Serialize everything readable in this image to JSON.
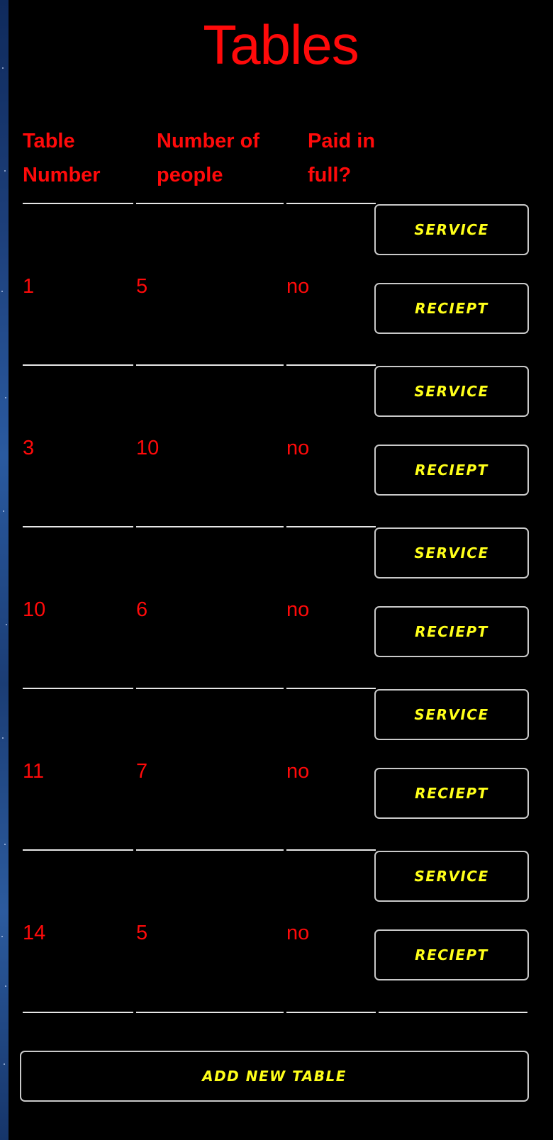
{
  "page": {
    "title": "Tables"
  },
  "table": {
    "headers": {
      "table_number": "Table Number",
      "number_of_people": "Number of people",
      "paid_in_full": "Paid in full?"
    },
    "rows": [
      {
        "table_number": "1",
        "people": "5",
        "paid": "no",
        "service_label": "SERVICE",
        "receipt_label": "RECIEPT"
      },
      {
        "table_number": "3",
        "people": "10",
        "paid": "no",
        "service_label": "SERVICE",
        "receipt_label": "RECIEPT"
      },
      {
        "table_number": "10",
        "people": "6",
        "paid": "no",
        "service_label": "SERVICE",
        "receipt_label": "RECIEPT"
      },
      {
        "table_number": "11",
        "people": "7",
        "paid": "no",
        "service_label": "SERVICE",
        "receipt_label": "RECIEPT"
      },
      {
        "table_number": "14",
        "people": "5",
        "paid": "no",
        "service_label": "SERVICE",
        "receipt_label": "RECIEPT"
      }
    ]
  },
  "actions": {
    "add_new_table_label": "ADD NEW TABLE"
  },
  "colors": {
    "background": "#000000",
    "text_red": "#ff0a0a",
    "button_text_yellow": "#ffff1a",
    "button_border": "#c9c9c9",
    "rule": "#e6e6e6"
  }
}
